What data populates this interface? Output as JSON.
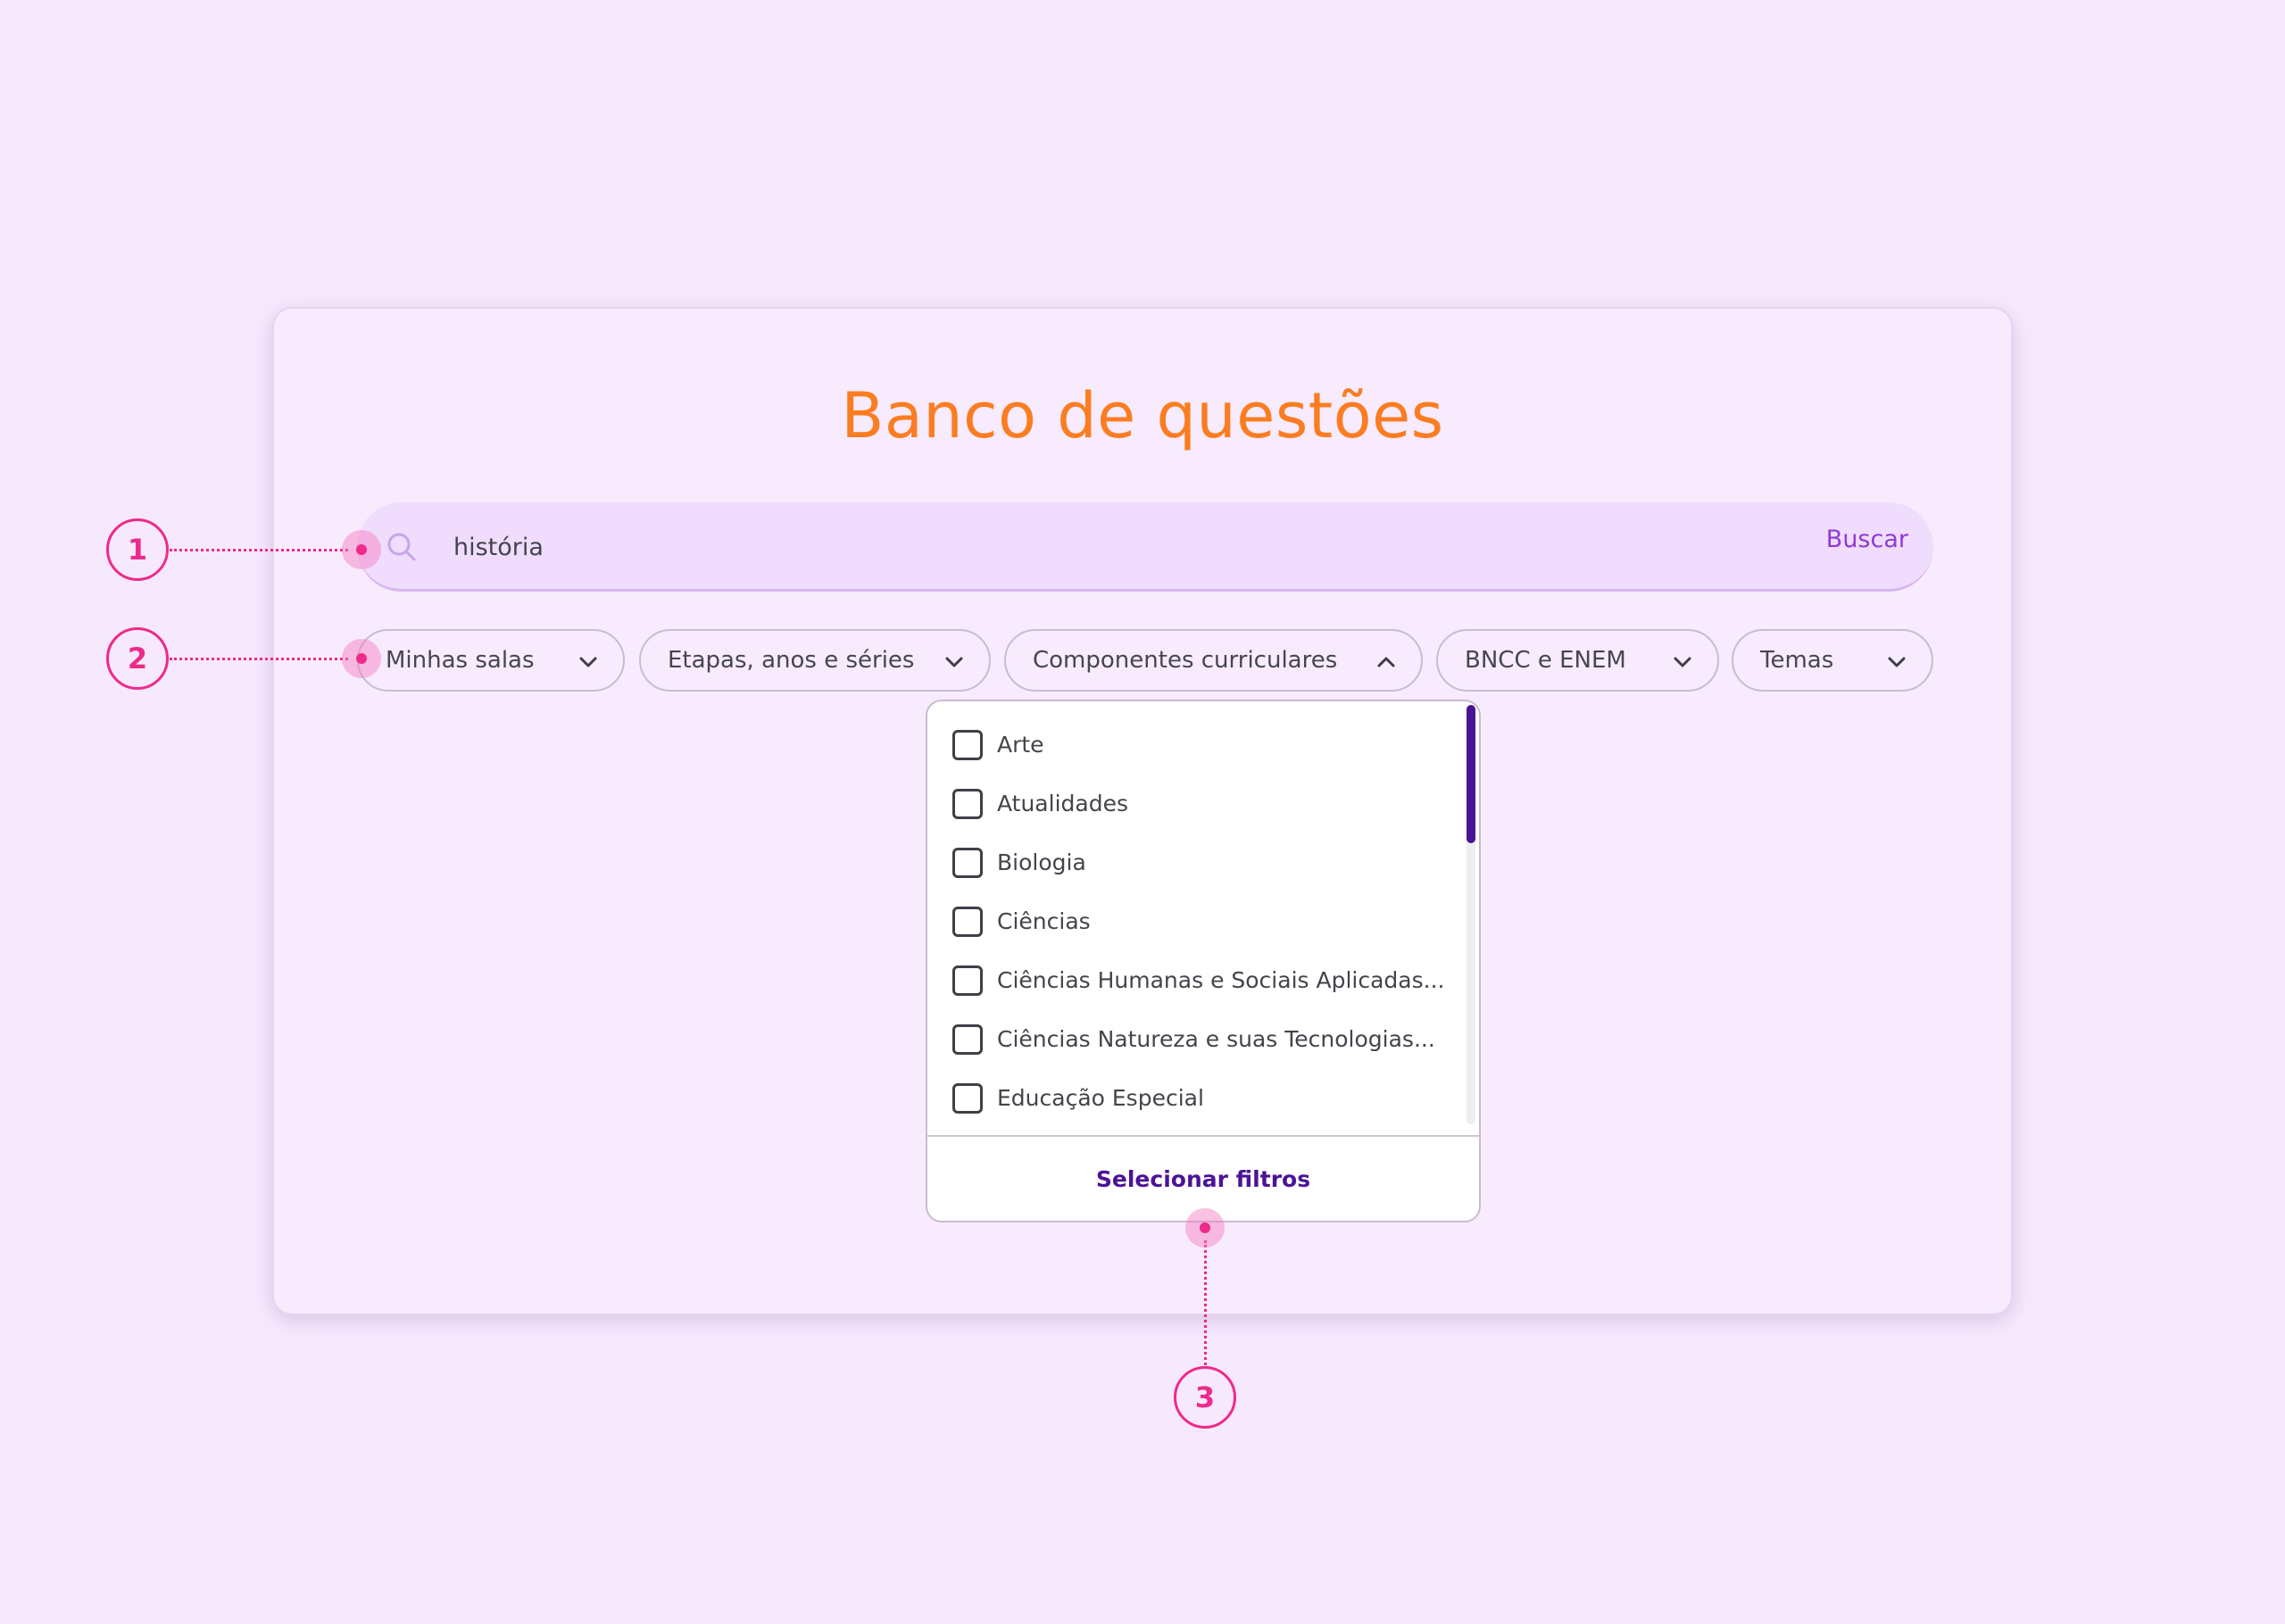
{
  "header": {
    "title": "Banco de questões"
  },
  "search": {
    "value": "história",
    "placeholder": "",
    "button_label": "Buscar"
  },
  "filters": [
    {
      "label": "Minhas salas",
      "state": "collapsed"
    },
    {
      "label": "Etapas, anos e séries",
      "state": "collapsed"
    },
    {
      "label": "Componentes curriculares",
      "state": "expanded"
    },
    {
      "label": "BNCC e ENEM",
      "state": "collapsed"
    },
    {
      "label": "Temas",
      "state": "collapsed"
    }
  ],
  "dropdown": {
    "options": [
      {
        "label": "Arte",
        "checked": false
      },
      {
        "label": "Atualidades",
        "checked": false
      },
      {
        "label": "Biologia",
        "checked": false
      },
      {
        "label": "Ciências",
        "checked": false
      },
      {
        "label": "Ciências Humanas e Sociais Aplicadas...",
        "checked": false
      },
      {
        "label": "Ciências Natureza e suas Tecnologias...",
        "checked": false
      },
      {
        "label": "Educação Especial",
        "checked": false
      }
    ],
    "apply_label": "Selecionar filtros"
  },
  "annotations": [
    "1",
    "2",
    "3"
  ],
  "colors": {
    "background": "#f6e9fd",
    "title": "#fb7d22",
    "accent": "#8d3bd6",
    "primary_dark": "#4b1496",
    "annotation": "#ee2a8a"
  },
  "icons": {
    "search": "search-icon",
    "collapsed": "chevron-down-icon",
    "expanded": "chevron-up-icon"
  }
}
